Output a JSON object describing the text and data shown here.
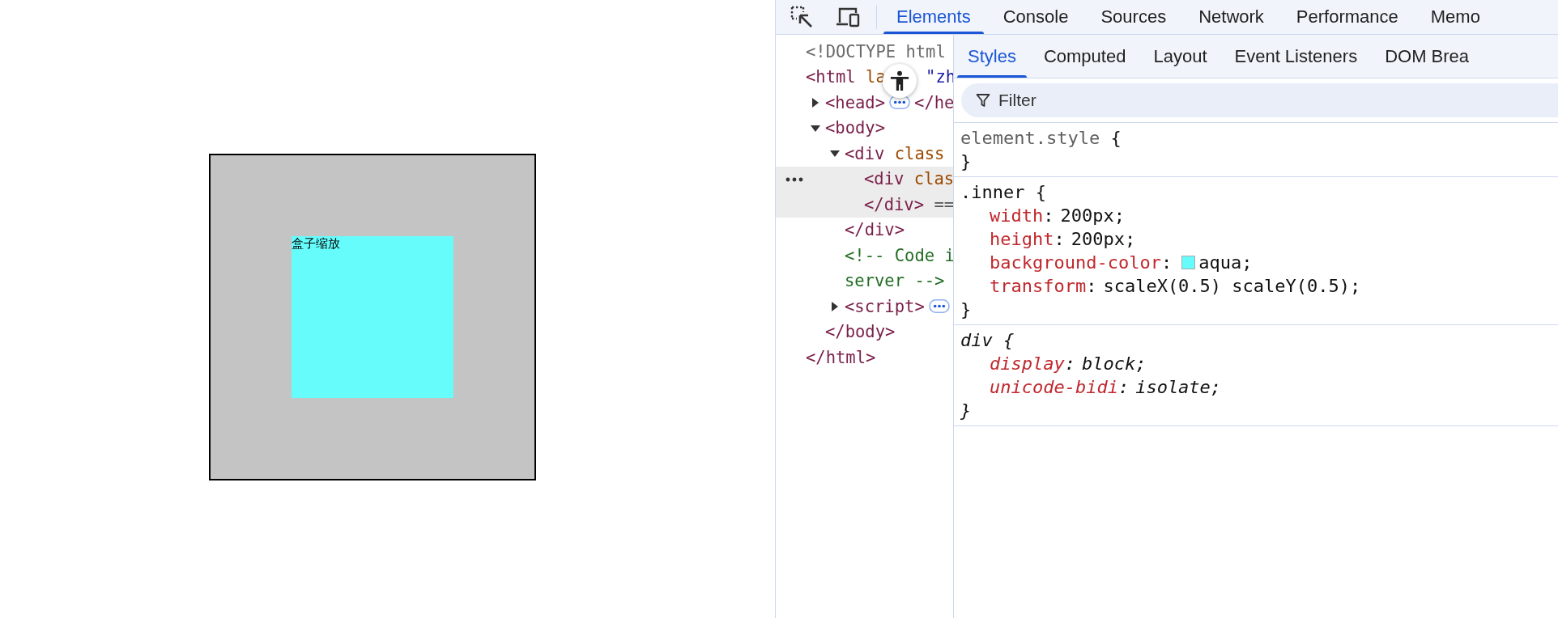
{
  "page": {
    "label": "盒子缩放"
  },
  "toolbar": {
    "icons": [
      {
        "kind": "inspect"
      },
      {
        "kind": "device"
      }
    ],
    "tabs": [
      {
        "label": "Elements",
        "selected": true
      },
      {
        "label": "Console",
        "selected": false
      },
      {
        "label": "Sources",
        "selected": false
      },
      {
        "label": "Network",
        "selected": false
      },
      {
        "label": "Performance",
        "selected": false
      },
      {
        "label": "Memo",
        "selected": false
      }
    ]
  },
  "dom_tree": [
    {
      "lines": [
        [
          {
            "kind": "doctype",
            "text": "<!DOCTYPE html"
          }
        ]
      ]
    },
    {
      "lines": [
        [
          {
            "kind": "tag",
            "text": "<html"
          },
          {
            "kind": "attr",
            "text": " la"
          },
          {
            "kind": "value",
            "text": "\"zh"
          }
        ]
      ],
      "close": [
        {
          "kind": "tag",
          "text": "</html>"
        }
      ],
      "children": [
        {
          "expanded": false,
          "lines": [
            [
              {
                "kind": "tag",
                "text": "<head>"
              },
              {
                "kind": "badge"
              },
              {
                "kind": "tag",
                "text": "</he"
              }
            ]
          ]
        },
        {
          "expanded": true,
          "lines": [
            [
              {
                "kind": "tag",
                "text": "<body>"
              }
            ]
          ],
          "close": [
            {
              "kind": "tag",
              "text": "</body>"
            }
          ],
          "children": [
            {
              "expanded": true,
              "lines": [
                [
                  {
                    "kind": "tag",
                    "text": "<div"
                  },
                  {
                    "kind": "attr",
                    "text": " class"
                  }
                ]
              ],
              "close": [
                {
                  "kind": "tag",
                  "text": "</div>"
                }
              ],
              "children": [
                {
                  "selected": true,
                  "lines": [
                    [
                      {
                        "kind": "tag",
                        "text": "<div"
                      },
                      {
                        "kind": "attr",
                        "text": " clas"
                      }
                    ],
                    [
                      {
                        "kind": "tag",
                        "text": "</div>"
                      },
                      {
                        "kind": "plain",
                        "text": " =="
                      }
                    ]
                  ]
                }
              ]
            },
            {
              "lines": [
                [
                  {
                    "kind": "comment",
                    "text": "<!-- Code i"
                  }
                ],
                [
                  {
                    "kind": "comment",
                    "text": "server -->"
                  }
                ]
              ]
            },
            {
              "expanded": false,
              "lines": [
                [
                  {
                    "kind": "tag",
                    "text": "<script>"
                  },
                  {
                    "kind": "badge"
                  }
                ]
              ]
            }
          ]
        }
      ]
    }
  ],
  "styles": {
    "tabs": [
      {
        "label": "Styles",
        "selected": true
      },
      {
        "label": "Computed",
        "selected": false
      },
      {
        "label": "Layout",
        "selected": false
      },
      {
        "label": "Event Listeners",
        "selected": false
      },
      {
        "label": "DOM Brea",
        "selected": false
      }
    ],
    "filter": {
      "placeholder": "Filter"
    },
    "rules": [
      {
        "kind": "inline",
        "selector": "element.style",
        "open": "{",
        "close": "}"
      },
      {
        "kind": "author",
        "selector": ".inner",
        "open": "{",
        "close": "}",
        "declarations": [
          {
            "name": "width",
            "sep": ":",
            "value": "200px;"
          },
          {
            "name": "height",
            "sep": ":",
            "value": "200px;"
          },
          {
            "name": "background-color",
            "sep": ":",
            "swatch": true,
            "value": "aqua;"
          },
          {
            "name": "transform",
            "sep": ":",
            "value": "scaleX(0.5) scaleY(0.5);"
          }
        ]
      },
      {
        "kind": "useragent",
        "selector": "div",
        "open": "{",
        "close": "}",
        "declarations": [
          {
            "name": "display",
            "sep": ":",
            "value": "block;"
          },
          {
            "name": "unicode-bidi",
            "sep": ":",
            "value": "isolate;"
          }
        ]
      }
    ]
  }
}
